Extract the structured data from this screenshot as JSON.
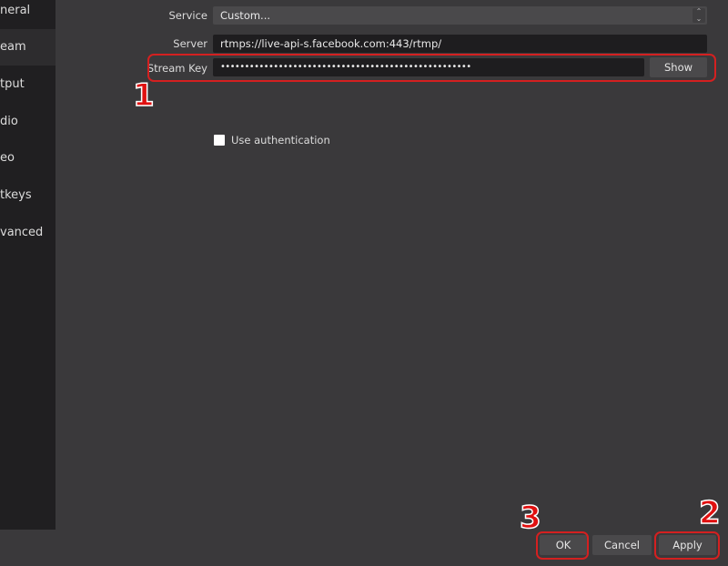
{
  "sidebar": {
    "items": [
      {
        "label": "neral"
      },
      {
        "label": "eam",
        "selected": true
      },
      {
        "label": "tput"
      },
      {
        "label": "dio"
      },
      {
        "label": "eo"
      },
      {
        "label": "tkeys"
      },
      {
        "label": "vanced"
      }
    ]
  },
  "form": {
    "service_label": "Service",
    "service_value": "Custom...",
    "server_label": "Server",
    "server_value": "rtmps://live-api-s.facebook.com:443/rtmp/",
    "stream_key_label": "Stream Key",
    "stream_key_value": "••••••••••••••••••••••••••••••••••••••••••••••••••••",
    "show_label": "Show",
    "use_auth_label": "Use authentication",
    "use_auth_checked": false
  },
  "footer": {
    "ok": "OK",
    "cancel": "Cancel",
    "apply": "Apply"
  },
  "annotations": {
    "step1": "1",
    "step2": "2",
    "step3": "3",
    "color": "#d42020"
  }
}
